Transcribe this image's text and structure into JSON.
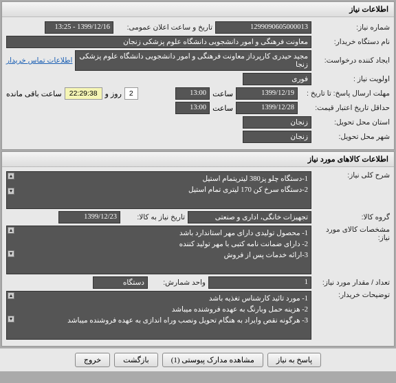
{
  "panel1": {
    "title": "اطلاعات نیاز",
    "need_no_label": "شماره نیاز:",
    "need_no": "1299090605000013",
    "announce_label": "تاریخ و ساعت اعلان عمومی:",
    "announce_value": "1399/12/16 - 13:25",
    "buyer_name_label": "نام دستگاه خریدار:",
    "buyer_name": "معاونت فرهنگی و امور دانشجویی دانشگاه علوم پزشکی زنجان",
    "creator_label": "ایجاد کننده درخواست:",
    "creator": "مجید حیدری کارپرداز معاونت فرهنگی و امور دانشجویی دانشگاه علوم پزشکی زنجا",
    "contact_link": "اطلاعات تماس خریدار",
    "priority_label": "اولویت نیاز :",
    "priority": "فوری",
    "deadline_label": "مهلت ارسال پاسخ:  تا تاریخ :",
    "deadline_date": "1399/12/19",
    "time_label": "ساعت",
    "deadline_time": "13:00",
    "days_remaining": "2",
    "days_and": "روز و",
    "countdown": "22:29:38",
    "remaining_label": "ساعت باقی مانده",
    "credit_label": "حداقل تاریخ اعتبار قیمت:",
    "credit_date": "1399/12/28",
    "credit_time": "13:00",
    "province_label": "استان محل تحویل:",
    "province": "زنجان",
    "city_label": "شهر محل تحویل:",
    "city": "زنجان"
  },
  "panel2": {
    "title": "اطلاعات کالاهای مورد نیاز",
    "desc_label": "شرح کلی نیاز:",
    "desc": "1-دستگاه چلو پز380 لیتریتمام استیل\n2-دستگاه سرخ کن 170 لیتری تمام استیل",
    "group_label": "گروه کالا:",
    "group": "تجهیزات خانگی، اداری و صنعتی",
    "need_date_label": "تاریخ نیاز به کالا:",
    "need_date": "1399/12/23",
    "spec_label": "مشخصات کالای مورد نیاز:",
    "spec": "1- محصول تولیدی دارای مهر استاندارد باشد\n2- دارای ضمانت نامه کتبی با مهر تولید کننده\n3-ارائه خدمات پس از فروش",
    "qty_label": "تعداد / مقدار مورد نیاز:",
    "qty": "1",
    "unit_label": "واحد شمارش:",
    "unit": "دستگاه",
    "notes_label": "توضیحات خریدار:",
    "notes": "1- مورد تائید کارشناس تغذیه باشد\n2- هزینه حمل وبارنگ به عهده فروشنده میباشد\n3- هرگونه نقص وایراد به هنگام تحویل ونصب وراه اندازی به عهده فروشنده میباشد"
  },
  "buttons": {
    "respond": "پاسخ به نیاز",
    "attachments": "مشاهده مدارک پیوستی (1)",
    "back": "بازگشت",
    "exit": "خروج"
  }
}
